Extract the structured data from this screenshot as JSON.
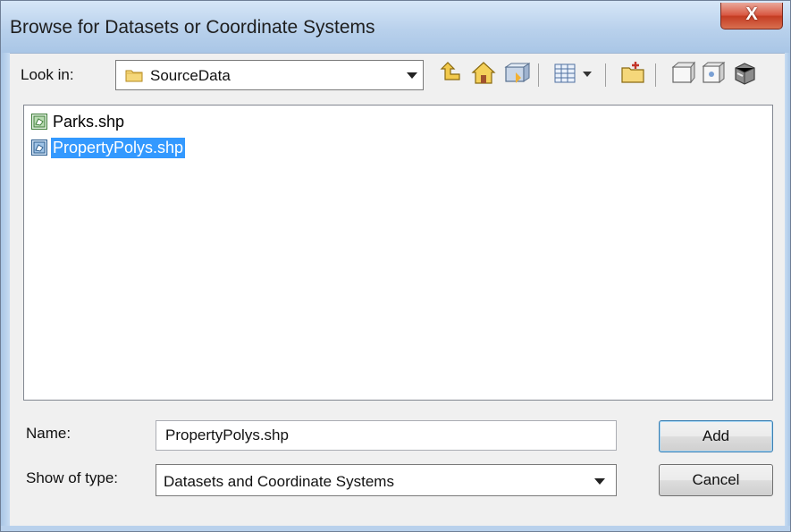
{
  "window": {
    "title": "Browse for Datasets or Coordinate Systems",
    "close_glyph": "X"
  },
  "look_in": {
    "label": "Look in:",
    "value": "SourceData",
    "icon": "folder-icon"
  },
  "toolbar": {
    "buttons": [
      {
        "name": "up-one-level-icon"
      },
      {
        "name": "home-icon"
      },
      {
        "name": "connect-to-folder-icon"
      },
      {
        "name": "view-menu-icon"
      },
      {
        "name": "new-folder-icon"
      },
      {
        "name": "new-item-icon"
      },
      {
        "name": "new-database-icon"
      },
      {
        "name": "catalog-options-icon"
      }
    ]
  },
  "files": [
    {
      "name": "Parks.shp",
      "selected": false,
      "icon": "polygon-shapefile-icon"
    },
    {
      "name": "PropertyPolys.shp",
      "selected": true,
      "icon": "polygon-shapefile-icon"
    }
  ],
  "name_field": {
    "label": "Name:",
    "value": "PropertyPolys.shp"
  },
  "type_field": {
    "label": "Show of type:",
    "value": "Datasets and Coordinate Systems"
  },
  "buttons": {
    "add": "Add",
    "cancel": "Cancel"
  },
  "colors": {
    "selection": "#3399ff",
    "titlebar": "#b9d1ec",
    "close_button": "#c43b22"
  }
}
